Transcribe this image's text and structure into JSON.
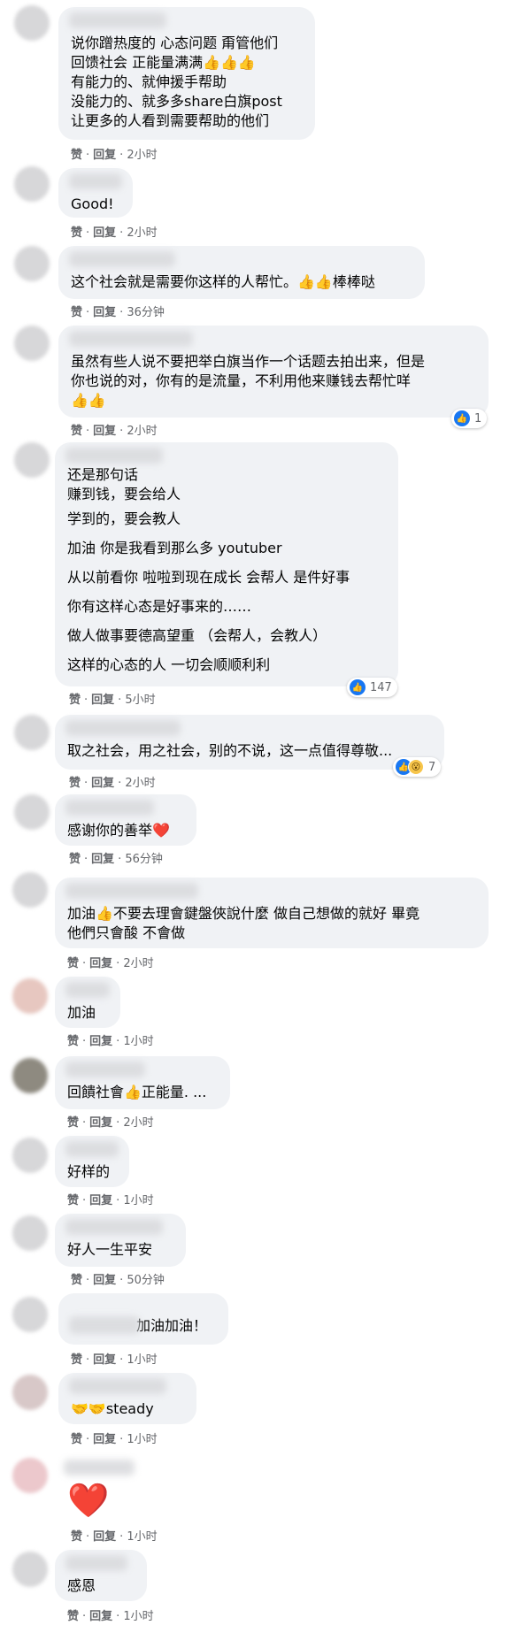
{
  "actions": {
    "like": "赞",
    "reply": "回复"
  },
  "comments": [
    {
      "lines": [
        "说你蹭热度的 心态问题 甭管他们",
        "回馈社会 正能量满满👍👍👍",
        "有能力的、就伸援手帮助",
        "没能力的、就多多share白旗post",
        "让更多的人看到需要帮助的他们"
      ],
      "time": "2小时"
    },
    {
      "lines": [
        "Good!"
      ],
      "time": "2小时"
    },
    {
      "lines": [
        "这个社会就是需要你这样的人帮忙。👍👍棒棒哒"
      ],
      "time": "36分钟"
    },
    {
      "lines": [
        "虽然有些人说不要把举白旗当作一个话题去拍出来，但是",
        "你也说的对，你有的是流量，不利用他来赚钱去帮忙咩",
        "👍👍"
      ],
      "time": "2小时",
      "reaction": {
        "count": "1"
      }
    },
    {
      "lines": [
        "还是那句话",
        "赚到钱，要会给人",
        "学到的，要会教人",
        "加油 你是我看到那么多 youtuber",
        "从以前看你 啦啦到现在成长 会帮人 是件好事",
        "你有这样心态是好事来的……",
        "做人做事要德高望重 （会帮人，会教人）",
        "这样的心态的人 一切会顺顺利利"
      ],
      "time": "5小时",
      "reaction": {
        "count": "147"
      }
    },
    {
      "lines": [
        "取之社会，用之社会，别的不说，这一点值得尊敬..."
      ],
      "time": "2小时",
      "reaction": {
        "count": "7"
      }
    },
    {
      "lines": [
        "感谢你的善举❤️"
      ],
      "time": "56分钟"
    },
    {
      "lines": [
        "加油👍不要去理會鍵盤俠說什麼 做自己想做的就好 畢竟",
        "他們只會酸 不會做"
      ],
      "time": "2小时"
    },
    {
      "lines": [
        "加油"
      ],
      "time": "1小时"
    },
    {
      "lines": [
        "回饋社會👍正能量. ..."
      ],
      "time": "2小时"
    },
    {
      "lines": [
        "好样的"
      ],
      "time": "1小时"
    },
    {
      "lines": [
        "好人一生平安"
      ],
      "time": "50分钟"
    },
    {
      "lines": [
        "加油加油！"
      ],
      "time": "1小时"
    },
    {
      "lines": [
        "🤝🤝steady"
      ],
      "time": "1小时"
    },
    {
      "lines": [
        "❤️"
      ],
      "time": "1小时"
    },
    {
      "lines": [
        "感恩"
      ],
      "time": "1小时"
    }
  ]
}
